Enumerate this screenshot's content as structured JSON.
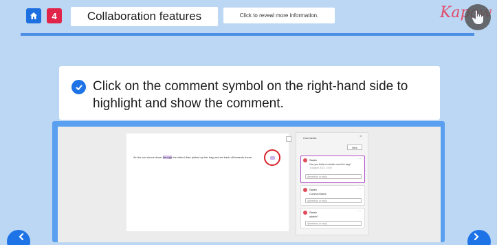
{
  "header": {
    "step_number": "4",
    "title": "Collaboration features",
    "hint": "Click to reveal more information.",
    "logo": "Kapow"
  },
  "instruction": {
    "text": "Click on the comment symbol on the right-hand side to highlight and show the comment."
  },
  "document": {
    "text_before": "As the sun shone down ",
    "text_highlight": "through",
    "text_after": " the cities Lilian picked up her bag and set back off towards home."
  },
  "comments_panel": {
    "title": "Comments",
    "close": "×",
    "new_label": "New",
    "comments": [
      {
        "author": "Sarah",
        "text": "Can you think of a better word for bag?",
        "time": "4 August 2021, 14:03",
        "reply_placeholder": "@mention or reply"
      },
      {
        "author": "Sarah",
        "text": "Comma missed.",
        "time": "",
        "reply_placeholder": "@mention or reply"
      },
      {
        "author": "Sarah",
        "text": "adverb?",
        "time": "",
        "reply_placeholder": "@mention or reply"
      }
    ]
  },
  "icons": {
    "home": "home-icon",
    "hand": "hand-pointer-icon",
    "check": "check-icon",
    "prev": "chevron-left-icon",
    "next": "chevron-right-icon"
  },
  "colors": {
    "background": "#bcd7f3",
    "accent_blue": "#1e73e6",
    "step_red": "#e0244a",
    "highlight_purple": "#b04cc9",
    "circle_red": "#d9222a"
  }
}
